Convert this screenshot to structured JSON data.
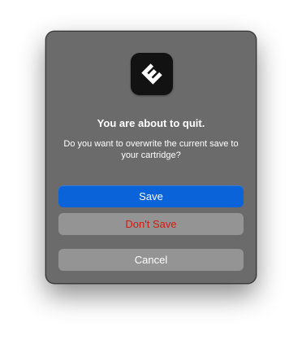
{
  "dialog": {
    "app_icon": "app-logo-icon",
    "title": "You are about to quit.",
    "message": "Do you want to overwrite the current save to your cartridge?",
    "buttons": {
      "save": "Save",
      "dont_save": "Don't Save",
      "cancel": "Cancel"
    }
  },
  "colors": {
    "dialog_bg": "#6b6b6b",
    "primary_button": "#0a63d8",
    "secondary_button": "#949494",
    "destructive_text": "#d21b12"
  }
}
